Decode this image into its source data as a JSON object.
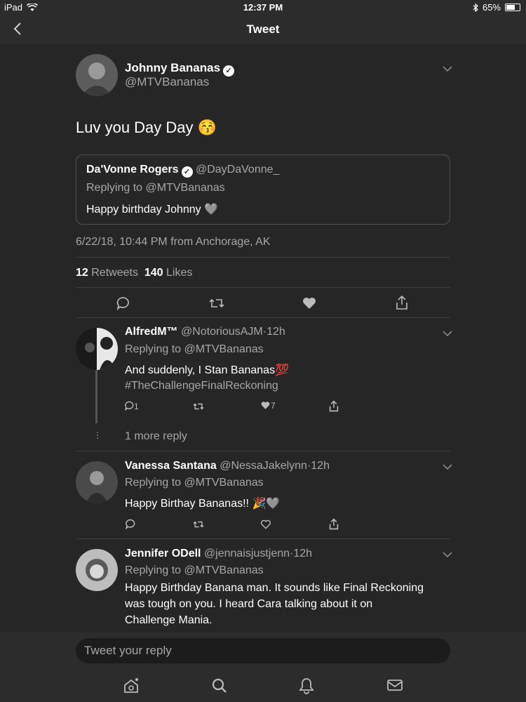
{
  "status_bar": {
    "device": "iPad",
    "time": "12:37 PM",
    "battery": "65%",
    "battery_level": 0.65
  },
  "nav": {
    "title": "Tweet"
  },
  "main_tweet": {
    "name": "Johnny Bananas",
    "handle": "@MTVBananas",
    "text": "Luv you Day Day 😚",
    "quote": {
      "name": "Da'Vonne Rogers",
      "handle": "@DayDaVonne_",
      "replying": "Replying to @MTVBananas",
      "text": "Happy birthday Johnny 🩶"
    },
    "timestamp": "6/22/18, 10:44 PM from",
    "location": "Anchorage, AK",
    "retweets_count": "12",
    "retweets_label": "Retweets",
    "likes_count": "140",
    "likes_label": "Likes"
  },
  "replies": [
    {
      "name": "AlfredM™",
      "handle": "@NotoriousAJM",
      "time": "·12h",
      "replying": "Replying to @MTVBananas",
      "text_line1": "And suddenly, I Stan Bananas💯",
      "hashtag": "#TheChallengeFinalReckoning",
      "reply_count": "1",
      "like_count": "7",
      "more_replies": "1 more reply"
    },
    {
      "name": "Vanessa Santana",
      "handle": "@NessaJakelynn",
      "time": "·12h",
      "replying": "Replying to @MTVBananas",
      "text": "Happy Birthay Bananas!! 🎉🩶"
    },
    {
      "name": "Jennifer ODell",
      "handle": "@jennaisjustjenn",
      "time": "·12h",
      "replying": "Replying to @MTVBananas",
      "text_line1": "Happy Birthday Banana man. It sounds like Final Reckoning",
      "text_line2": "was tough on you. I heard Cara talking about it on",
      "text_line3": "Challenge Mania."
    }
  ],
  "reply_box": {
    "placeholder": "Tweet your reply"
  },
  "tab_icons": [
    "home-icon",
    "search-icon",
    "notifications-icon",
    "messages-icon"
  ]
}
